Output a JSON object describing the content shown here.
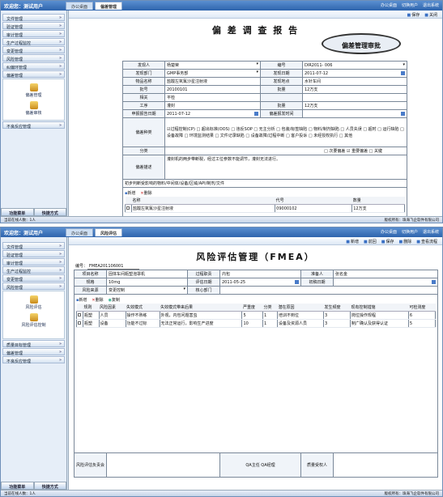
{
  "shot1": {
    "welcome": "欢迎您：测试用户",
    "tabs": [
      "办公桌面",
      "偏差管理"
    ],
    "top_right": [
      "办公桌面",
      "切换用户",
      "退出系统"
    ],
    "sidebar": {
      "head": "欢迎您：测试用户",
      "items": [
        "文件管理",
        "验证管理",
        "审计管理",
        "生产过程监控",
        "变更管理",
        "风险管理",
        "纠偏环管理",
        "偏差管理"
      ],
      "subs": [
        "偏差管理",
        "偏差审核"
      ],
      "after": [
        "不良反应管理"
      ],
      "bottom": [
        "功能菜单",
        "快捷方式"
      ]
    },
    "toolbar": [
      "保存",
      "关闭"
    ],
    "title": "偏 差 调 查 报 告",
    "bubble": "偏差管理审批",
    "rows": [
      [
        "发现人",
        "杨楚荣",
        "编号",
        "DIR2011- 006"
      ],
      [
        "发现部门",
        "GMP事务部",
        "发现日期",
        "2011-07-12"
      ],
      [
        "物品名称",
        "盐酸左氧氟沙星注射液",
        "发现地点",
        "水针车间"
      ],
      [
        "批号",
        "20100101",
        "批量",
        "12万支"
      ],
      [
        "相关",
        "平检",
        "",
        " "
      ],
      [
        "工序",
        "灌封",
        "批量",
        "12万支"
      ],
      [
        "申报报告日期",
        "2011-07-12",
        "偏差报发时间",
        ""
      ]
    ],
    "type_label": "偏差种类",
    "types": "☑过程控制(CP) □ 超出标准(OOS) □ 违反SOP □ 无主分析 □ 包装/标签缺陷 □ 物料/制剂缺陷 □ 人员失误 □ 超时 □ 运行缺陷 □ 设备故障 □ 环境监测结果 □ 文件记录缺陷 □ 设备故障/过程中断 □ 客户投诉 □ 未经授权执行 □ 其他",
    "class_label": "分类",
    "classes": "□ 次要偏差 ☑ 重要偏差 □ 关键",
    "desc_label": "偏差描述",
    "desc": "灌封机的两步带断裂，经过工位参数不能调节，灌封无法进行。",
    "affected_label": "初步判断受影响的物料/中间体/设备/区域/API/制剂/文件",
    "ops": [
      "新增",
      "删除"
    ],
    "grid_headers": [
      "名称",
      "代号",
      "数量"
    ],
    "grid_rows": [
      [
        "盐酸左氧氟沙星注射液",
        "09000102",
        "12万支"
      ]
    ],
    "status_left": "当前在线人数：1人",
    "status_right": "版权所有：珠海飞企软件有限公司"
  },
  "shot2": {
    "welcome": "欢迎您：测试用户",
    "tabs": [
      "办公桌面",
      "风险评估"
    ],
    "top_right": [
      "办公桌面",
      "切换用户",
      "退出系统"
    ],
    "sidebar": {
      "items": [
        "文件管理",
        "验证管理",
        "审计管理",
        "生产过程监控",
        "变更管理",
        "风险管理"
      ],
      "subs": [
        "风险评估",
        "风险评估控制"
      ],
      "after": [
        "质量目标管理",
        "偏差管理",
        "不良反应管理"
      ],
      "bottom": [
        "功能菜单",
        "快捷方式"
      ]
    },
    "toolbar": [
      "新增",
      "前回",
      "保存",
      "删除",
      "查看流程"
    ],
    "title": "风险评估管理（FMEA）",
    "no_label": "编号：",
    "no": "FMEA201106001",
    "rows": [
      [
        "项目名称",
        "固体车间瓶塑泡罩机",
        "过程职责",
        "内包",
        "准备人",
        "张名金"
      ],
      [
        "规格",
        "10mg",
        "评估日期",
        "2011-05-25",
        "初稿日期",
        ""
      ],
      [
        "风险来源",
        "变更控制",
        "核心部门",
        "",
        "",
        ""
      ]
    ],
    "ops": [
      "新增",
      "删除",
      "复制"
    ],
    "grid_headers": [
      "规则",
      "风险因素",
      "失效模式",
      "失效模式带来后果",
      "严重度",
      "分类",
      "潜在原因",
      "发生频度",
      "现有控制措施",
      "可检测度"
    ],
    "grid_rows": [
      [
        "瓶塑",
        "人员",
        "操作不熟练",
        "外观，内包问题害虫",
        "5",
        "1",
        "培训不到位",
        "3",
        "岗位操作规程",
        "6"
      ],
      [
        "瓶塑",
        "设备",
        "功能不过标",
        "无法正常运行，影响生产进度",
        "10",
        "1",
        "设备及资源人员",
        "3",
        "制广确认及获得认证",
        "5"
      ]
    ],
    "footer": [
      "风险评估负责会",
      "QA主任 QA经理",
      "质量受权人"
    ],
    "status_left": "当前在线人数：1人",
    "status_right": "版权所有：珠海飞企软件有限公司"
  }
}
